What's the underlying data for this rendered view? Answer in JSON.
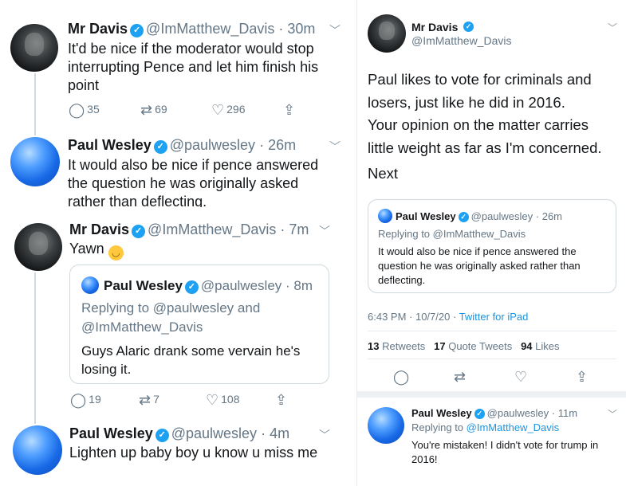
{
  "left": {
    "tweets": [
      {
        "name": "Mr Davis",
        "handle": "@ImMatthew_Davis",
        "time": "30m",
        "text": "It'd be nice if the moderator would stop interrupting Pence and let him finish his point",
        "replies": "35",
        "retweets": "69",
        "likes": "296"
      },
      {
        "name": "Paul Wesley",
        "handle": "@paulwesley",
        "time": "26m",
        "text": "It would also be nice if pence answered the question he was originally asked rather than deflecting."
      },
      {
        "name": "Mr Davis",
        "handle": "@ImMatthew_Davis",
        "time": "7m",
        "text": "Yawn",
        "replies": "19",
        "retweets": "7",
        "likes": "108",
        "quote": {
          "name": "Paul Wesley",
          "handle": "@paulwesley",
          "time": "8m",
          "replying_label": "Replying to",
          "replying_to": "@paulwesley",
          "and_label": "and",
          "replying_to_2": "@ImMatthew_Davis",
          "text": "Guys Alaric drank some vervain he's losing it."
        }
      },
      {
        "name": "Paul Wesley",
        "handle": "@paulwesley",
        "time": "4m",
        "text": "Lighten up baby boy u know u miss me"
      }
    ]
  },
  "right": {
    "main": {
      "name": "Mr Davis",
      "handle": "@ImMatthew_Davis",
      "text_lines": [
        "Paul likes to vote for criminals and",
        "losers, just like he did in 2016.",
        "Your opinion on the matter carries",
        "little weight as far as I'm concerned."
      ],
      "next": "Next",
      "quote": {
        "name": "Paul Wesley",
        "handle": "@paulwesley",
        "time": "26m",
        "replying_label": "Replying to",
        "replying_to": "@ImMatthew_Davis",
        "text_lines": [
          "It would also be nice if pence answered the",
          "question he was originally asked rather than",
          "deflecting."
        ]
      },
      "timestamp": "6:43 PM · 10/7/20 · ",
      "source": "Twitter for iPad",
      "stats": {
        "retweets_count": "13",
        "retweets_label": "Retweets",
        "quotes_count": "17",
        "quotes_label": "Quote Tweets",
        "likes_count": "94",
        "likes_label": "Likes"
      }
    },
    "reply": {
      "name": "Paul Wesley",
      "handle": "@paulwesley",
      "time": "11m",
      "replying_label": "Replying to",
      "replying_to": "@ImMatthew_Davis",
      "text_lines": [
        "You're mistaken! I didn't vote for trump in",
        "2016!"
      ]
    }
  },
  "icons": {
    "reply": "reply-icon",
    "retweet": "retweet-icon",
    "like": "heart-icon",
    "share": "share-icon",
    "verified": "verified-badge-icon",
    "more": "chevron-down-icon"
  },
  "colors": {
    "accent": "#1da1f2",
    "link": "#1b95e0",
    "muted": "#657786"
  }
}
